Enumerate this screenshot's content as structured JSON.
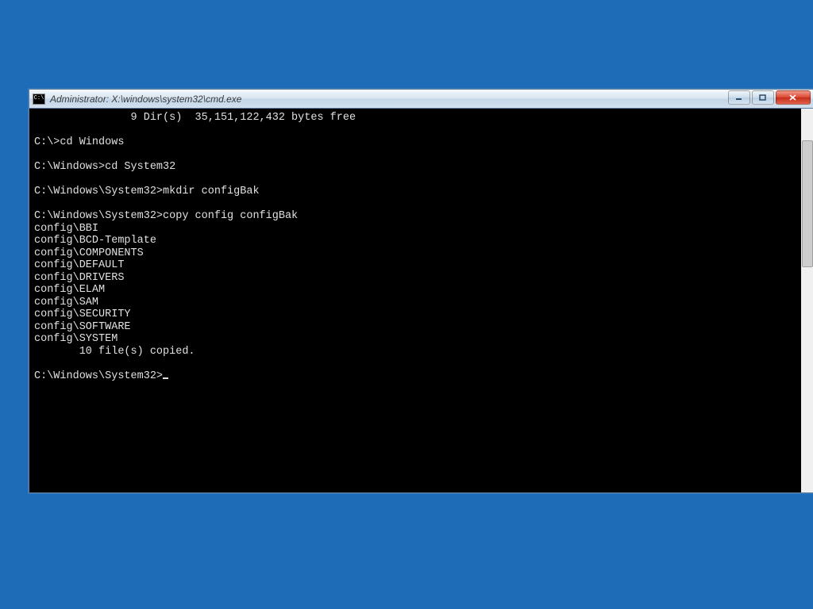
{
  "window": {
    "title": "Administrator: X:\\windows\\system32\\cmd.exe",
    "icon_label": "C:\\"
  },
  "terminal": {
    "lines": [
      "               9 Dir(s)  35,151,122,432 bytes free",
      "",
      "C:\\>cd Windows",
      "",
      "C:\\Windows>cd System32",
      "",
      "C:\\Windows\\System32>mkdir configBak",
      "",
      "C:\\Windows\\System32>copy config configBak",
      "config\\BBI",
      "config\\BCD-Template",
      "config\\COMPONENTS",
      "config\\DEFAULT",
      "config\\DRIVERS",
      "config\\ELAM",
      "config\\SAM",
      "config\\SECURITY",
      "config\\SOFTWARE",
      "config\\SYSTEM",
      "       10 file(s) copied.",
      ""
    ],
    "prompt": "C:\\Windows\\System32>"
  }
}
